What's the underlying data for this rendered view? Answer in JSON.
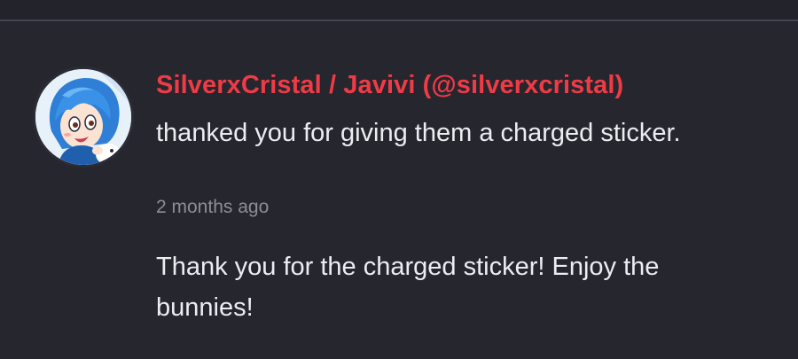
{
  "notification": {
    "avatar_icon": "user-avatar-blue-haired-character",
    "user_display": "SilverxCristal / Javivi (@silverxcristal)",
    "action": "thanked you for giving them a charged sticker.",
    "time_ago": "2 months ago",
    "message": "Thank you for the charged sticker! Enjoy the bunnies!"
  },
  "colors": {
    "background": "#26262f",
    "username": "#ef3b45",
    "text": "#ececf1",
    "muted": "#8d8d96"
  }
}
